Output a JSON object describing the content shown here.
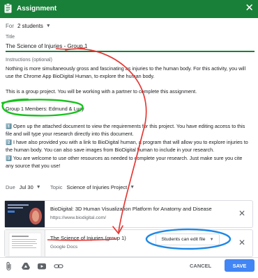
{
  "header": {
    "title": "Assignment",
    "icon": "assignment-icon",
    "close_icon": "close-icon",
    "color": "#188038"
  },
  "for": {
    "label": "For",
    "value": "2 students"
  },
  "title_field": {
    "label": "Title",
    "value": "The Science of Injuries - Group 1"
  },
  "instructions": {
    "label": "Instructions (optional)",
    "p1": "Nothing is more simultaneously gross and fascinating as injuries to the human body. For this activity, you will use the Chrome App BioDigital Human, to explore the human body.",
    "p2": "This is a group project. You will be working with a partner to complete this assignment.",
    "p3": "Group 1 Members: Edmund & Lucy",
    "p4": "1️⃣ Open up the attached document to view the requirements for this project. You have editing access to this file and will type your research directly into this document.",
    "p5": "2️⃣ I have also provided you with a link to BioDigital human, a program that will allow you to explore injuries to the human body. You can also save images from BioDigital human to include in your research.",
    "p6": "3️⃣ You are welcome to use other resources as needed to complete your research. Just make sure you cite any source that you use!"
  },
  "due": {
    "label": "Due",
    "value": "Jul 30"
  },
  "topic": {
    "label": "Topic",
    "value": "Science of Injuries Project"
  },
  "attachments": [
    {
      "title": "BioDigital: 3D Human Visualization Platform for Anatomy and Disease",
      "subtitle": "https://www.biodigital.com/"
    },
    {
      "title": "The Science of Injuries (group 1)",
      "subtitle": "Google Docs",
      "permission": "Students can edit file"
    }
  ],
  "footer": {
    "icons": [
      "paperclip-icon",
      "drive-icon",
      "youtube-icon",
      "link-icon"
    ],
    "cancel": "CANCEL",
    "save": "SAVE"
  },
  "annotation_colors": {
    "red": "#e53935",
    "green": "#18c21e",
    "blue": "#1e88e5"
  }
}
